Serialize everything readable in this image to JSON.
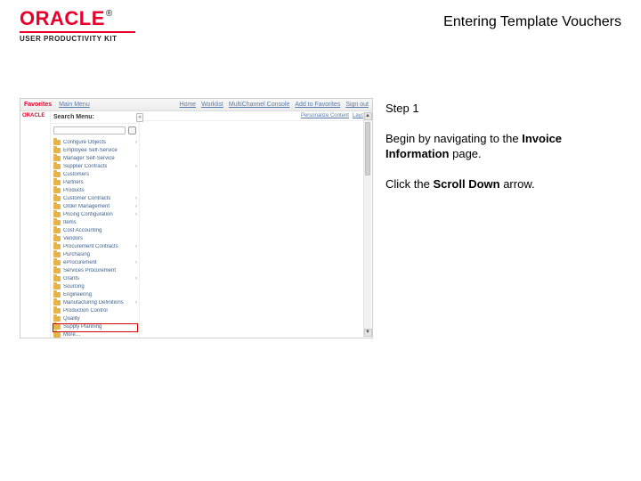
{
  "header": {
    "brand": "ORACLE",
    "reg": "®",
    "upk": "USER PRODUCTIVITY KIT",
    "title": "Entering Template Vouchers"
  },
  "instructions": {
    "step_label": "Step 1",
    "line1_pre": "Begin by navigating to the ",
    "line1_bold": "Invoice Information",
    "line1_post": " page.",
    "line2_pre": "Click the ",
    "line2_bold": "Scroll Down",
    "line2_post": " arrow."
  },
  "app": {
    "topbar_left": "Favorites",
    "topbar_main_menu": "Main Menu",
    "topbar_links": [
      "Home",
      "Worklist",
      "MultiChannel Console",
      "Add to Favorites",
      "Sign out"
    ],
    "oracle_small": "ORACLE",
    "search_label": "Search Menu:",
    "collapse_glyph": "«",
    "canvas_links": [
      "Personalize Content",
      "Layout"
    ],
    "scroll_up": "▲",
    "scroll_down": "▼",
    "menu": [
      {
        "label": "Configure Objects",
        "arrow": true
      },
      {
        "label": "Employee Self-Service",
        "arrow": false
      },
      {
        "label": "Manager Self-Service",
        "arrow": false
      },
      {
        "label": "Supplier Contracts",
        "arrow": true
      },
      {
        "label": "Customers",
        "arrow": false
      },
      {
        "label": "Partners",
        "arrow": false
      },
      {
        "label": "Products",
        "arrow": false
      },
      {
        "label": "Customer Contracts",
        "arrow": true
      },
      {
        "label": "Order Management",
        "arrow": true
      },
      {
        "label": "Pricing Configuration",
        "arrow": true
      },
      {
        "label": "Items",
        "arrow": false
      },
      {
        "label": "Cost Accounting",
        "arrow": false
      },
      {
        "label": "Vendors",
        "arrow": false
      },
      {
        "label": "Procurement Contracts",
        "arrow": true
      },
      {
        "label": "Purchasing",
        "arrow": false
      },
      {
        "label": "eProcurement",
        "arrow": true
      },
      {
        "label": "Services Procurement",
        "arrow": false
      },
      {
        "label": "Grants",
        "arrow": true
      },
      {
        "label": "Sourcing",
        "arrow": false
      },
      {
        "label": "Engineering",
        "arrow": false
      },
      {
        "label": "Manufacturing Definitions",
        "arrow": true
      },
      {
        "label": "Production Control",
        "arrow": false
      },
      {
        "label": "Quality",
        "arrow": false
      },
      {
        "label": "Supply Planning",
        "arrow": false
      },
      {
        "label": "More…",
        "arrow": false
      }
    ]
  }
}
